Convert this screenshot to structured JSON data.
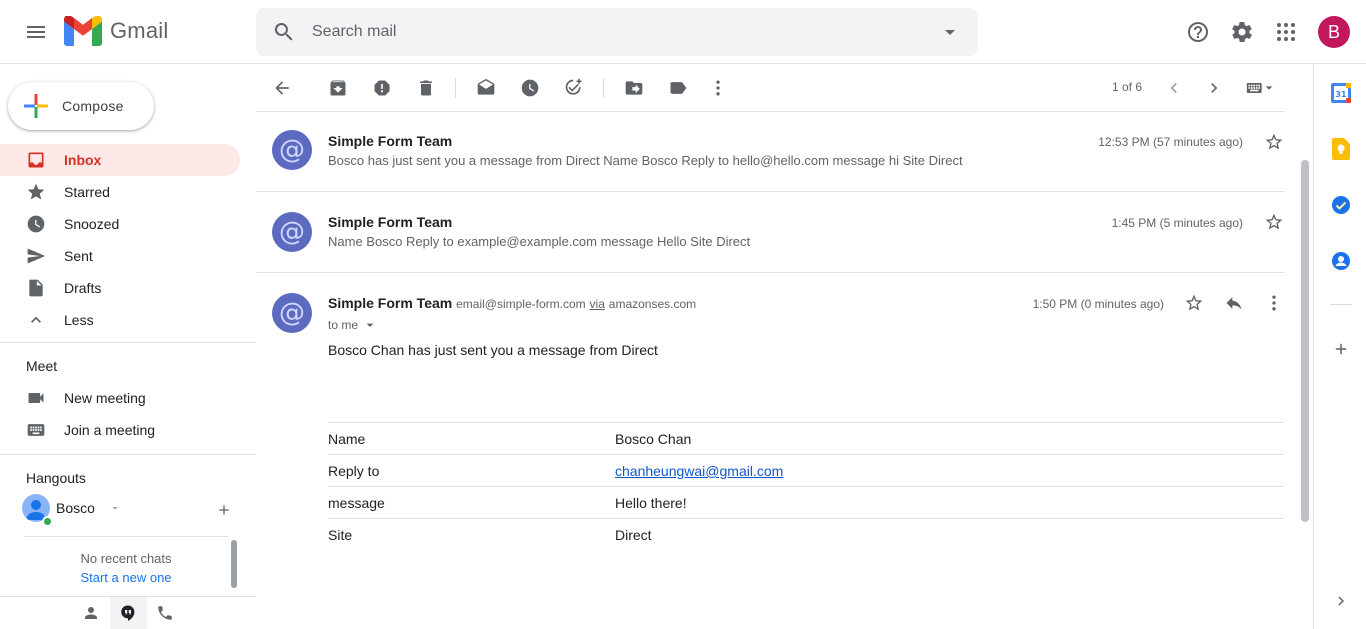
{
  "header": {
    "app_name": "Gmail",
    "search_placeholder": "Search mail",
    "avatar_letter": "B"
  },
  "nav": {
    "compose_label": "Compose",
    "items": [
      {
        "label": "Inbox",
        "icon": "inbox-icon",
        "active": true
      },
      {
        "label": "Starred",
        "icon": "star-icon"
      },
      {
        "label": "Snoozed",
        "icon": "clock-icon"
      },
      {
        "label": "Sent",
        "icon": "send-icon"
      },
      {
        "label": "Drafts",
        "icon": "draft-icon"
      },
      {
        "label": "Less",
        "icon": "chevron-up-icon"
      }
    ],
    "meet": {
      "title": "Meet",
      "new_meeting": "New meeting",
      "join_meeting": "Join a meeting"
    },
    "hangouts": {
      "title": "Hangouts",
      "user_name": "Bosco",
      "no_chats": "No recent chats",
      "start_new": "Start a new one"
    }
  },
  "toolbar": {
    "pager": "1 of 6"
  },
  "messages": [
    {
      "sender": "Simple Form Team",
      "time": "12:53 PM (57 minutes ago)",
      "snippet": "Bosco has just sent you a message from Direct Name Bosco Reply to hello@hello.com message hi Site Direct"
    },
    {
      "sender": "Simple Form Team",
      "time": "1:45 PM (5 minutes ago)",
      "snippet": "Name Bosco Reply to example@example.com message Hello Site Direct"
    },
    {
      "sender": "Simple Form Team",
      "email": "email@simple-form.com",
      "via_label": "via",
      "via_domain": "amazonses.com",
      "time": "1:50 PM (0 minutes ago)",
      "to": "to me",
      "body": "Bosco Chan has just sent you a message from Direct",
      "fields": [
        {
          "key": "Name",
          "value": "Bosco Chan"
        },
        {
          "key": "Reply to",
          "value": "chanheungwai@gmail.com"
        },
        {
          "key": "message",
          "value": "Hello there!"
        },
        {
          "key": "Site",
          "value": "Direct"
        }
      ]
    }
  ],
  "colors": {
    "accent_red": "#d93025",
    "active_bg": "#fce8e6",
    "avatar_bg": "#c2185b",
    "sender_avatar_bg": "#5c6bc0",
    "link": "#1155cc"
  }
}
